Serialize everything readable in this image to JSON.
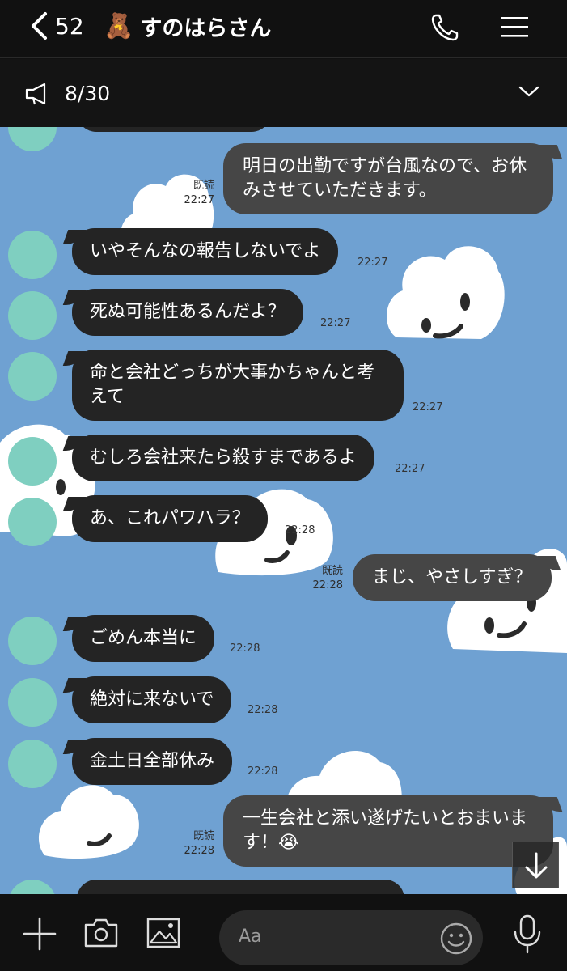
{
  "header": {
    "back_count": "52",
    "bear_emoji": "🧸",
    "title": "すのはらさん"
  },
  "announcement": {
    "text": "8/30"
  },
  "messages": [
    {
      "dir": "out",
      "lines": [
        "明日の出勤ですが台風なので、お休",
        "みさせていただきます。"
      ],
      "read": "既読",
      "time": "22:27"
    },
    {
      "dir": "in",
      "text": "いやそんなの報告しないでよ",
      "time": "22:27"
    },
    {
      "dir": "in",
      "text": "死ぬ可能性あるんだよ？",
      "time": "22:27"
    },
    {
      "dir": "in",
      "lines": [
        "命と会社どっちが大事かちゃんと考",
        "えて"
      ],
      "time": "22:27"
    },
    {
      "dir": "in",
      "text": "むしろ会社来たら殺すまであるよ",
      "time": "22:27"
    },
    {
      "dir": "in",
      "text": "あ、これパワハラ？",
      "time": "22:28"
    },
    {
      "dir": "out",
      "text": "まじ、やさしすぎ？",
      "read": "既読",
      "time": "22:28"
    },
    {
      "dir": "in",
      "text": "ごめん本当に",
      "time": "22:28"
    },
    {
      "dir": "in",
      "text": "絶対に来ないで",
      "time": "22:28"
    },
    {
      "dir": "in",
      "text": "金土日全部休み",
      "time": "22:28"
    },
    {
      "dir": "out",
      "lines": [
        "一生会社と添い遂げたいとおまいま",
        "す！😭"
      ],
      "read": "既読",
      "time": "22:28"
    }
  ],
  "input": {
    "placeholder": "Aa"
  },
  "icons": [
    "chevron-left-icon",
    "phone-icon",
    "hamburger-icon",
    "megaphone-icon",
    "chevron-down-icon",
    "plus-icon",
    "camera-icon",
    "image-icon",
    "smile-icon",
    "microphone-icon",
    "arrow-down-icon"
  ],
  "colors": {
    "chat_background": "#6fa1d2",
    "incoming_bubble": "#242424",
    "outgoing_bubble": "#464646",
    "header": "#111111"
  }
}
